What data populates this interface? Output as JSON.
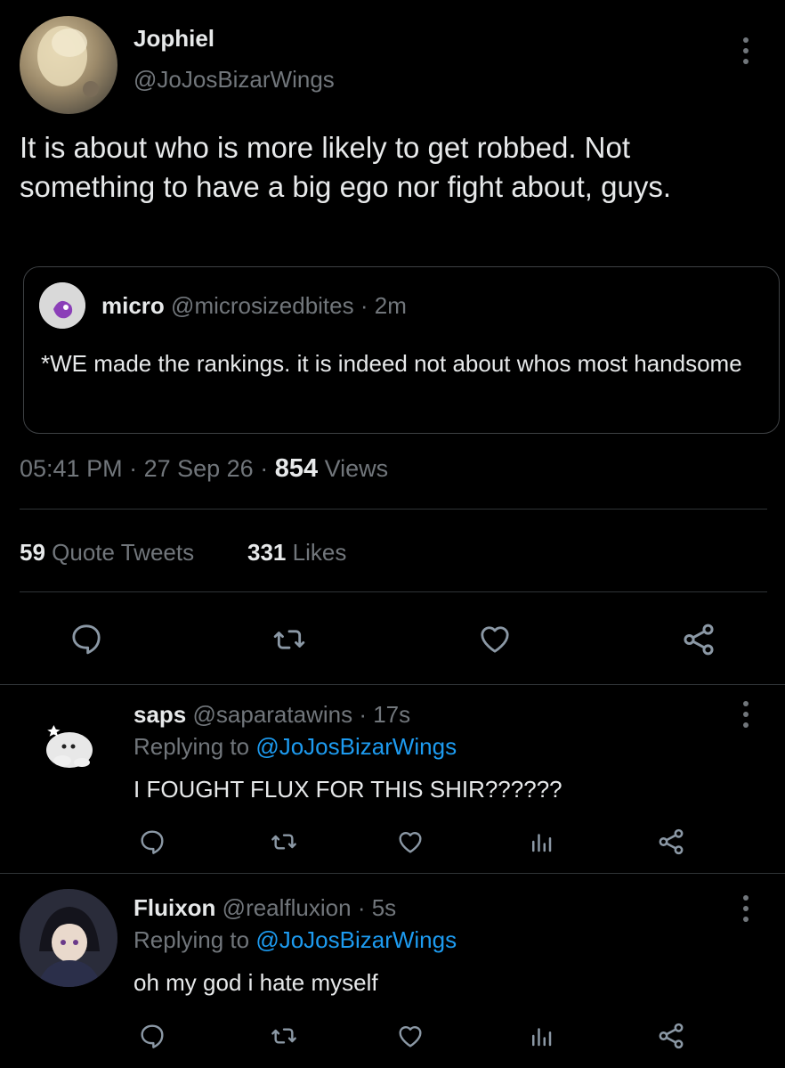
{
  "main_tweet": {
    "author_name": "Jophiel",
    "author_handle": "@JoJosBizarWings",
    "text": "It is about who is more likely to get robbed. Not something to have a big ego nor fight about, guys.",
    "quoted": {
      "author_name": "micro",
      "author_handle": "@microsizedbites",
      "separator": "·",
      "time": "2m",
      "text": "*WE made the rankings. it is indeed not about whos most handsome"
    },
    "time": "05:41 PM",
    "date": "27 Sep 26",
    "views_count": "854",
    "views_label": "Views",
    "quote_tweets_count": "59",
    "quote_tweets_label": "Quote Tweets",
    "likes_count": "331",
    "likes_label": "Likes"
  },
  "replies": [
    {
      "author_name": "saps",
      "author_handle": "@saparatawins",
      "time": "17s",
      "replying_label": "Replying to",
      "replying_to": "@JoJosBizarWings",
      "text": "I FOUGHT FLUX FOR THIS SHIR??????"
    },
    {
      "author_name": "Fluixon",
      "author_handle": "@realfluxion",
      "time": "5s",
      "replying_label": "Replying to",
      "replying_to": "@JoJosBizarWings",
      "text": "oh my god i hate myself"
    }
  ],
  "colors": {
    "background": "#000000",
    "text": "#e7e9ea",
    "muted": "#71767b",
    "accent": "#1d9bf0",
    "divider": "#2f3336"
  }
}
